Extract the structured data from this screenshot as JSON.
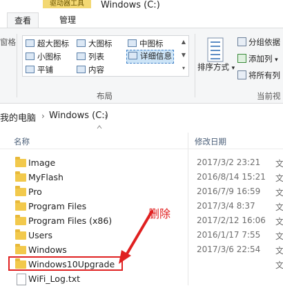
{
  "window": {
    "title": "Windows (C:)",
    "contextual_tab": "驱动器工具"
  },
  "tabs": [
    {
      "label": "查看"
    },
    {
      "label": "管理"
    }
  ],
  "ribbon": {
    "layout_items": [
      {
        "label": "超大图标"
      },
      {
        "label": "大图标"
      },
      {
        "label": "中图标"
      },
      {
        "label": "小图标"
      },
      {
        "label": "列表"
      },
      {
        "label": "详细信息"
      },
      {
        "label": "平铺"
      },
      {
        "label": "内容"
      }
    ],
    "left_partial": "窗格",
    "layout_group_label": "布局",
    "sort_label": "排序方式",
    "group_by": "分组依据",
    "add_column": "添加列",
    "fit_columns": "将所有列",
    "current_view_label": "当前视"
  },
  "address": {
    "parts": [
      "我的电脑",
      "Windows (C:)"
    ]
  },
  "columns": {
    "name": "名称",
    "date": "修改日期"
  },
  "rows": [
    {
      "name": "Image",
      "date": "2017/3/2 23:21",
      "type": "文"
    },
    {
      "name": "MyFlash",
      "date": "2016/8/14 15:21",
      "type": "文"
    },
    {
      "name": "Pro",
      "date": "2016/7/9 16:59",
      "type": "文"
    },
    {
      "name": "Program Files",
      "date": "2017/3/4 8:37",
      "type": "文"
    },
    {
      "name": "Program Files (x86)",
      "date": "2017/2/12 16:06",
      "type": "文"
    },
    {
      "name": "Users",
      "date": "2016/1/17 7:55",
      "type": "文"
    },
    {
      "name": "Windows",
      "date": "2017/3/6 22:54",
      "type": "文"
    },
    {
      "name": "Windows10Upgrade",
      "date": "",
      "type": "文"
    },
    {
      "name": "WiFi_Log.txt",
      "date": "",
      "type": ""
    }
  ],
  "annotation": {
    "text": "删除",
    "color": "#e02020"
  }
}
